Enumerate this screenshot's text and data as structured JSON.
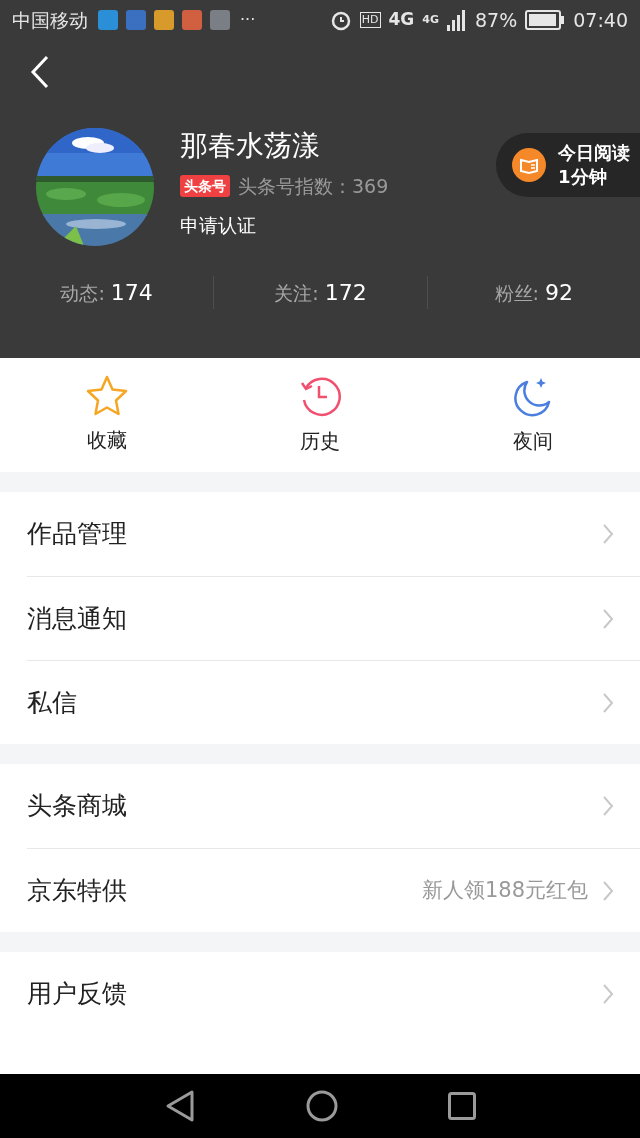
{
  "status_bar": {
    "carrier": "中国移动",
    "more": "···",
    "hd": "HD",
    "network": "4G",
    "network_2": "4G",
    "battery": "87%",
    "time": "07:40"
  },
  "profile": {
    "name": "那春水荡漾",
    "badge": "头条号",
    "index_label": "头条号指数：369",
    "verify": "申请认证",
    "reading": {
      "line_1": "今日阅读",
      "line_2": "1分钟"
    },
    "stats": [
      {
        "label": "动态:",
        "value": "174"
      },
      {
        "label": "关注:",
        "value": "172"
      },
      {
        "label": "粉丝:",
        "value": "92"
      }
    ]
  },
  "shortcuts": [
    {
      "kind": "star",
      "label": "收藏"
    },
    {
      "kind": "history",
      "label": "历史"
    },
    {
      "kind": "night",
      "label": "夜间"
    }
  ],
  "menu_groups": [
    [
      {
        "label": "作品管理"
      },
      {
        "label": "消息通知"
      },
      {
        "label": "私信"
      }
    ],
    [
      {
        "label": "头条商城"
      },
      {
        "label": "京东特供",
        "note": "新人领188元红包"
      }
    ],
    [
      {
        "label": "用户反馈"
      }
    ]
  ]
}
